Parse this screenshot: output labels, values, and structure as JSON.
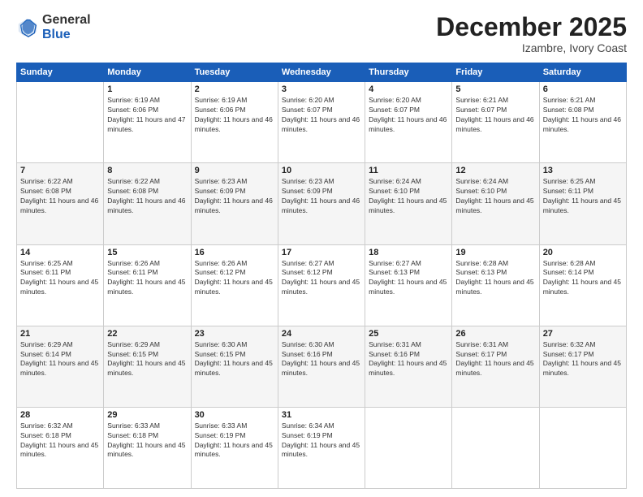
{
  "header": {
    "logo": {
      "general": "General",
      "blue": "Blue"
    },
    "title": "December 2025",
    "subtitle": "Izambre, Ivory Coast"
  },
  "weekdays": [
    "Sunday",
    "Monday",
    "Tuesday",
    "Wednesday",
    "Thursday",
    "Friday",
    "Saturday"
  ],
  "weeks": [
    [
      {
        "date": "",
        "sunrise": "",
        "sunset": "",
        "daylight": ""
      },
      {
        "date": "1",
        "sunrise": "Sunrise: 6:19 AM",
        "sunset": "Sunset: 6:06 PM",
        "daylight": "Daylight: 11 hours and 47 minutes."
      },
      {
        "date": "2",
        "sunrise": "Sunrise: 6:19 AM",
        "sunset": "Sunset: 6:06 PM",
        "daylight": "Daylight: 11 hours and 46 minutes."
      },
      {
        "date": "3",
        "sunrise": "Sunrise: 6:20 AM",
        "sunset": "Sunset: 6:07 PM",
        "daylight": "Daylight: 11 hours and 46 minutes."
      },
      {
        "date": "4",
        "sunrise": "Sunrise: 6:20 AM",
        "sunset": "Sunset: 6:07 PM",
        "daylight": "Daylight: 11 hours and 46 minutes."
      },
      {
        "date": "5",
        "sunrise": "Sunrise: 6:21 AM",
        "sunset": "Sunset: 6:07 PM",
        "daylight": "Daylight: 11 hours and 46 minutes."
      },
      {
        "date": "6",
        "sunrise": "Sunrise: 6:21 AM",
        "sunset": "Sunset: 6:08 PM",
        "daylight": "Daylight: 11 hours and 46 minutes."
      }
    ],
    [
      {
        "date": "7",
        "sunrise": "Sunrise: 6:22 AM",
        "sunset": "Sunset: 6:08 PM",
        "daylight": "Daylight: 11 hours and 46 minutes."
      },
      {
        "date": "8",
        "sunrise": "Sunrise: 6:22 AM",
        "sunset": "Sunset: 6:08 PM",
        "daylight": "Daylight: 11 hours and 46 minutes."
      },
      {
        "date": "9",
        "sunrise": "Sunrise: 6:23 AM",
        "sunset": "Sunset: 6:09 PM",
        "daylight": "Daylight: 11 hours and 46 minutes."
      },
      {
        "date": "10",
        "sunrise": "Sunrise: 6:23 AM",
        "sunset": "Sunset: 6:09 PM",
        "daylight": "Daylight: 11 hours and 46 minutes."
      },
      {
        "date": "11",
        "sunrise": "Sunrise: 6:24 AM",
        "sunset": "Sunset: 6:10 PM",
        "daylight": "Daylight: 11 hours and 45 minutes."
      },
      {
        "date": "12",
        "sunrise": "Sunrise: 6:24 AM",
        "sunset": "Sunset: 6:10 PM",
        "daylight": "Daylight: 11 hours and 45 minutes."
      },
      {
        "date": "13",
        "sunrise": "Sunrise: 6:25 AM",
        "sunset": "Sunset: 6:11 PM",
        "daylight": "Daylight: 11 hours and 45 minutes."
      }
    ],
    [
      {
        "date": "14",
        "sunrise": "Sunrise: 6:25 AM",
        "sunset": "Sunset: 6:11 PM",
        "daylight": "Daylight: 11 hours and 45 minutes."
      },
      {
        "date": "15",
        "sunrise": "Sunrise: 6:26 AM",
        "sunset": "Sunset: 6:11 PM",
        "daylight": "Daylight: 11 hours and 45 minutes."
      },
      {
        "date": "16",
        "sunrise": "Sunrise: 6:26 AM",
        "sunset": "Sunset: 6:12 PM",
        "daylight": "Daylight: 11 hours and 45 minutes."
      },
      {
        "date": "17",
        "sunrise": "Sunrise: 6:27 AM",
        "sunset": "Sunset: 6:12 PM",
        "daylight": "Daylight: 11 hours and 45 minutes."
      },
      {
        "date": "18",
        "sunrise": "Sunrise: 6:27 AM",
        "sunset": "Sunset: 6:13 PM",
        "daylight": "Daylight: 11 hours and 45 minutes."
      },
      {
        "date": "19",
        "sunrise": "Sunrise: 6:28 AM",
        "sunset": "Sunset: 6:13 PM",
        "daylight": "Daylight: 11 hours and 45 minutes."
      },
      {
        "date": "20",
        "sunrise": "Sunrise: 6:28 AM",
        "sunset": "Sunset: 6:14 PM",
        "daylight": "Daylight: 11 hours and 45 minutes."
      }
    ],
    [
      {
        "date": "21",
        "sunrise": "Sunrise: 6:29 AM",
        "sunset": "Sunset: 6:14 PM",
        "daylight": "Daylight: 11 hours and 45 minutes."
      },
      {
        "date": "22",
        "sunrise": "Sunrise: 6:29 AM",
        "sunset": "Sunset: 6:15 PM",
        "daylight": "Daylight: 11 hours and 45 minutes."
      },
      {
        "date": "23",
        "sunrise": "Sunrise: 6:30 AM",
        "sunset": "Sunset: 6:15 PM",
        "daylight": "Daylight: 11 hours and 45 minutes."
      },
      {
        "date": "24",
        "sunrise": "Sunrise: 6:30 AM",
        "sunset": "Sunset: 6:16 PM",
        "daylight": "Daylight: 11 hours and 45 minutes."
      },
      {
        "date": "25",
        "sunrise": "Sunrise: 6:31 AM",
        "sunset": "Sunset: 6:16 PM",
        "daylight": "Daylight: 11 hours and 45 minutes."
      },
      {
        "date": "26",
        "sunrise": "Sunrise: 6:31 AM",
        "sunset": "Sunset: 6:17 PM",
        "daylight": "Daylight: 11 hours and 45 minutes."
      },
      {
        "date": "27",
        "sunrise": "Sunrise: 6:32 AM",
        "sunset": "Sunset: 6:17 PM",
        "daylight": "Daylight: 11 hours and 45 minutes."
      }
    ],
    [
      {
        "date": "28",
        "sunrise": "Sunrise: 6:32 AM",
        "sunset": "Sunset: 6:18 PM",
        "daylight": "Daylight: 11 hours and 45 minutes."
      },
      {
        "date": "29",
        "sunrise": "Sunrise: 6:33 AM",
        "sunset": "Sunset: 6:18 PM",
        "daylight": "Daylight: 11 hours and 45 minutes."
      },
      {
        "date": "30",
        "sunrise": "Sunrise: 6:33 AM",
        "sunset": "Sunset: 6:19 PM",
        "daylight": "Daylight: 11 hours and 45 minutes."
      },
      {
        "date": "31",
        "sunrise": "Sunrise: 6:34 AM",
        "sunset": "Sunset: 6:19 PM",
        "daylight": "Daylight: 11 hours and 45 minutes."
      },
      {
        "date": "",
        "sunrise": "",
        "sunset": "",
        "daylight": ""
      },
      {
        "date": "",
        "sunrise": "",
        "sunset": "",
        "daylight": ""
      },
      {
        "date": "",
        "sunrise": "",
        "sunset": "",
        "daylight": ""
      }
    ]
  ]
}
